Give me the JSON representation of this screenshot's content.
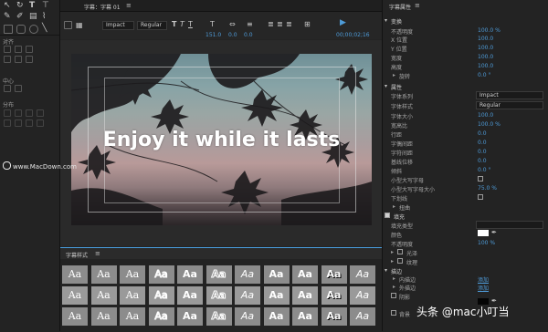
{
  "left_panel": {
    "labels": [
      "对齐",
      "中心",
      "分布"
    ]
  },
  "title_bar": {
    "tab_label": "字幕：字幕 01",
    "menu_symbol": "≡"
  },
  "toolbar": {
    "font_family": "Impact",
    "font_style": "Regular",
    "font_size": "151.0",
    "kerning": "0.0",
    "leading": "0.0",
    "timecode": "00;00;02;16"
  },
  "canvas": {
    "main_text": "Enjoy it while it lasts",
    "watermark": "www.MacDown.com"
  },
  "styles_panel": {
    "title": "字幕样式",
    "menu_symbol": "≡",
    "swatch_text": "Aa"
  },
  "properties": {
    "panel_title": "字幕属性",
    "menu_symbol": "≡",
    "transform_header": "变换",
    "opacity_label": "不透明度",
    "opacity_value": "100.0 %",
    "xpos_label": "X 位置",
    "xpos_value": "100.0",
    "ypos_label": "Y 位置",
    "ypos_value": "100.0",
    "width_label": "宽度",
    "width_value": "100.0",
    "height_label": "高度",
    "height_value": "100.0",
    "rotation_label": "旋转",
    "rotation_value": "0.0 °",
    "attributes_header": "属性",
    "font_family_label": "字体系列",
    "font_family_value": "Impact",
    "font_style_label": "字体样式",
    "font_style_value": "Regular",
    "font_size_label": "字体大小",
    "font_size_value": "100.0",
    "aspect_label": "宽高比",
    "aspect_value": "100.0 %",
    "leading_label": "行距",
    "leading_value": "0.0",
    "kerning_label": "字偶间距",
    "kerning_value": "0.0",
    "tracking_label": "字符间距",
    "tracking_value": "0.0",
    "baseline_label": "基线位移",
    "baseline_value": "0.0",
    "skew_label": "倾斜",
    "skew_value": "0.0 °",
    "smallcaps_label": "小型大写字母",
    "smallcaps_size_label": "小型大写字母大小",
    "smallcaps_size_value": "75.0 %",
    "underline_label": "下划线",
    "distort_label": "扭曲",
    "fill_header": "填充",
    "fill_type_label": "填充类型",
    "color_label": "颜色",
    "fill_opacity_label": "不透明度",
    "fill_opacity_value": "100 %",
    "sheen_label": "光泽",
    "texture_label": "纹理",
    "stroke_header": "描边",
    "inner_stroke_label": "内描边",
    "inner_stroke_action": "添加",
    "outer_stroke_label": "外描边",
    "outer_stroke_action": "添加",
    "shadow_label": "阴影",
    "background_label": "背景"
  },
  "brand": "头条 @mac小叮当"
}
